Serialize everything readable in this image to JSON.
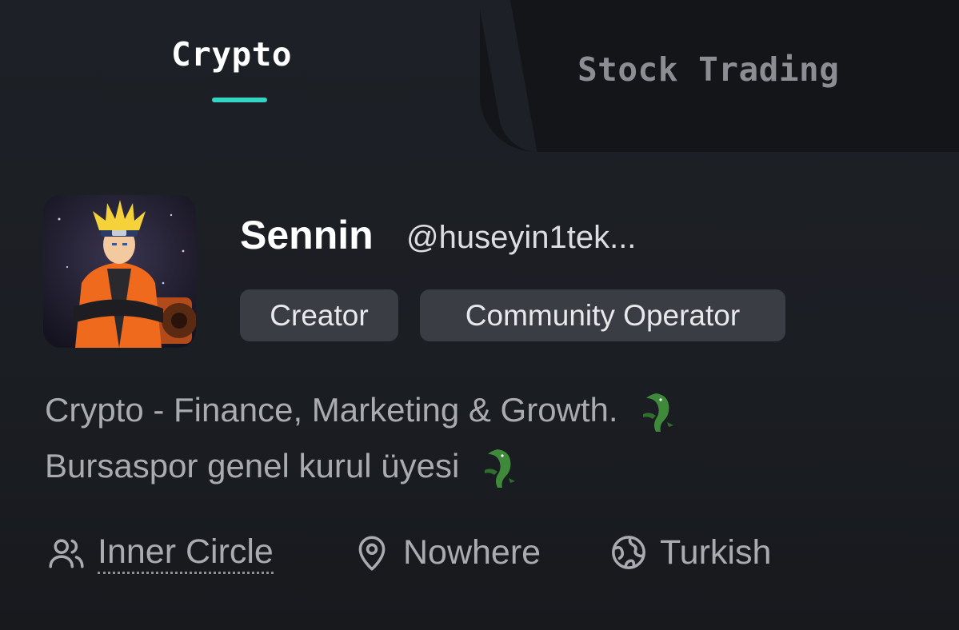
{
  "tabs": [
    {
      "label": "Crypto",
      "active": true
    },
    {
      "label": "Stock Trading",
      "active": false
    }
  ],
  "profile": {
    "name": "Sennin",
    "handle": "@huseyin1tek...",
    "avatar": "anime-ninja-avatar",
    "badges": [
      "Creator",
      "Community Operator"
    ],
    "bio": [
      "Crypto - Finance, Marketing & Growth.",
      "Bursaspor genel kurul üyesi"
    ],
    "bio_emoji": "crocodile-emoji"
  },
  "meta": {
    "community": {
      "icon": "users-icon",
      "label": "Inner Circle"
    },
    "location": {
      "icon": "map-pin-icon",
      "label": "Nowhere"
    },
    "language": {
      "icon": "globe-icon",
      "label": "Turkish"
    }
  },
  "colors": {
    "background": "#1d2026",
    "inactive_tab_bg": "#131518",
    "accent": "#34d6c3",
    "badge_bg": "#3a3d44",
    "muted_text": "#a9abb0"
  }
}
